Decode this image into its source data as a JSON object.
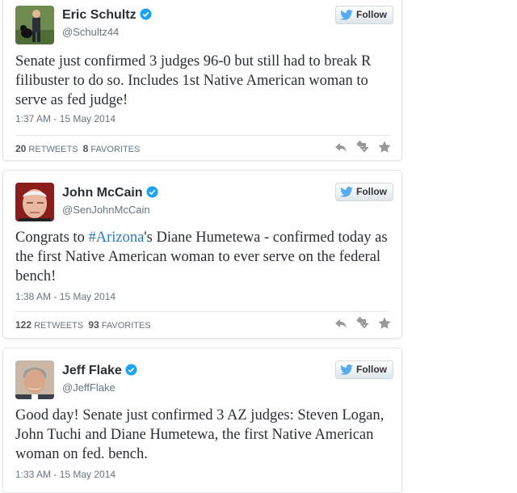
{
  "tweets": [
    {
      "name": "Eric Schultz",
      "handle": "@Schultz44",
      "follow_label": "Follow",
      "text_parts": [
        "Senate just confirmed 3 judges 96-0 but still had to break R filibuster to do so. Includes 1st Native American woman to serve as fed judge!"
      ],
      "timestamp": "1:37 AM - 15 May 2014",
      "retweets": "20",
      "retweets_label": "RETWEETS",
      "favorites": "8",
      "favorites_label": "FAVORITES"
    },
    {
      "name": "John McCain",
      "handle": "@SenJohnMcCain",
      "follow_label": "Follow",
      "text_before": "Congrats to ",
      "hashtag": "#Arizona",
      "text_after": "'s Diane Humetewa - confirmed today as the first Native American woman to ever serve on the federal bench!",
      "timestamp": "1:38 AM - 15 May 2014",
      "retweets": "122",
      "retweets_label": "RETWEETS",
      "favorites": "93",
      "favorites_label": "FAVORITES"
    },
    {
      "name": "Jeff Flake",
      "handle": "@JeffFlake",
      "follow_label": "Follow",
      "text": "Good day! Senate just confirmed 3 AZ judges: Steven Logan, John Tuchi and Diane Humetewa, the first Native American woman on fed. bench.",
      "timestamp": "1:33 AM - 15 May 2014"
    }
  ],
  "colors": {
    "twitter_blue": "#55acee",
    "hashtag": "#2b7bb9",
    "verified": "#1da1f2"
  },
  "icons": [
    "twitter-bird-icon",
    "verified-badge-icon",
    "reply-icon",
    "retweet-icon",
    "favorite-star-icon"
  ]
}
